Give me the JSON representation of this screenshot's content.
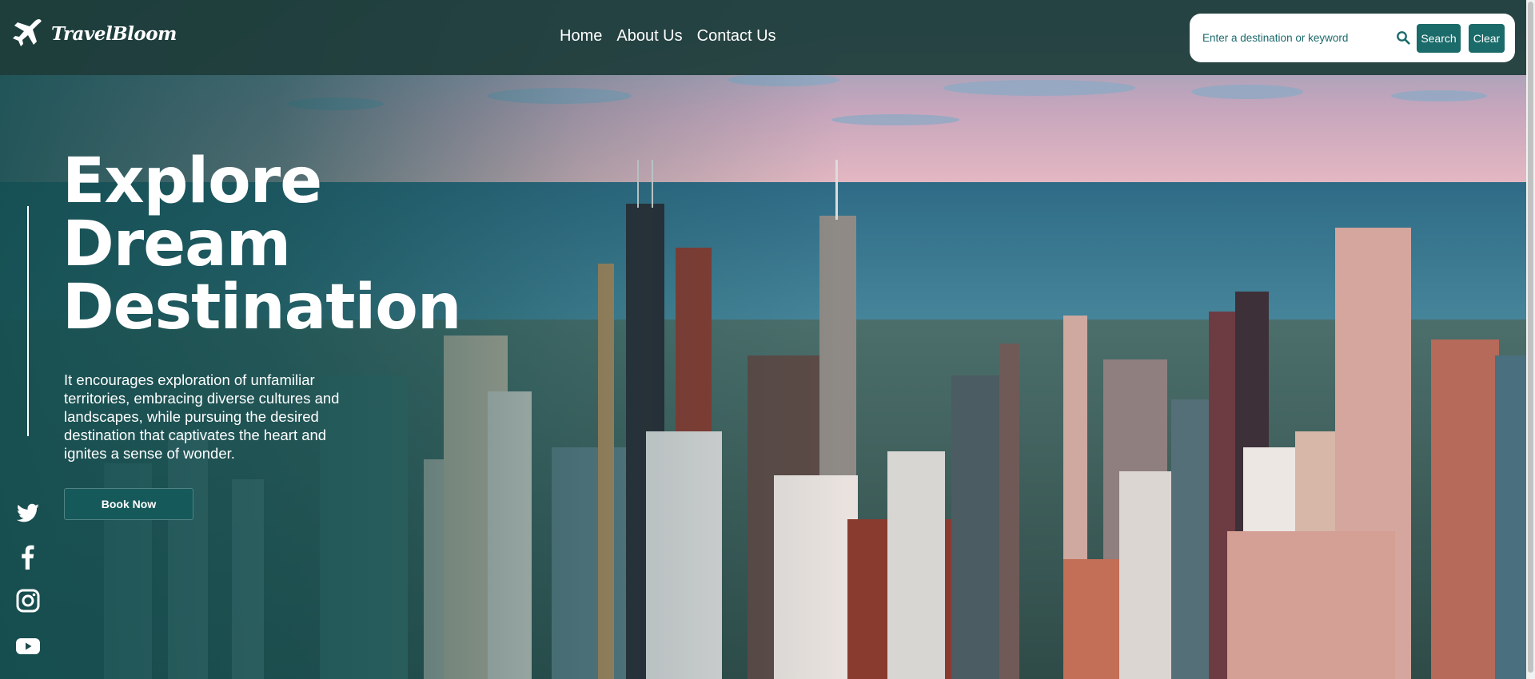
{
  "brand": {
    "name": "TravelBloom",
    "icon": "airplane-icon"
  },
  "nav": {
    "home": "Home",
    "about": "About Us",
    "contact": "Contact Us"
  },
  "search": {
    "placeholder": "Enter a destination or keyword",
    "search_label": "Search",
    "clear_label": "Clear",
    "icon": "magnifier-icon"
  },
  "hero": {
    "headline_line1": "Explore",
    "headline_line2": "Dream",
    "headline_line3": "Destination",
    "description": "It encourages exploration of unfamiliar territories, embracing diverse cultures and landscapes, while pursuing the desired destination that captivates the heart and ignites a sense of wonder.",
    "cta_label": "Book Now",
    "background": "aerial view of city skyline by a lake at dusk"
  },
  "social": [
    "twitter-icon",
    "facebook-icon",
    "instagram-icon",
    "youtube-icon"
  ],
  "colors": {
    "accent": "#1a6b6a",
    "navbar": "#1e3c3a",
    "text": "#ffffff"
  }
}
